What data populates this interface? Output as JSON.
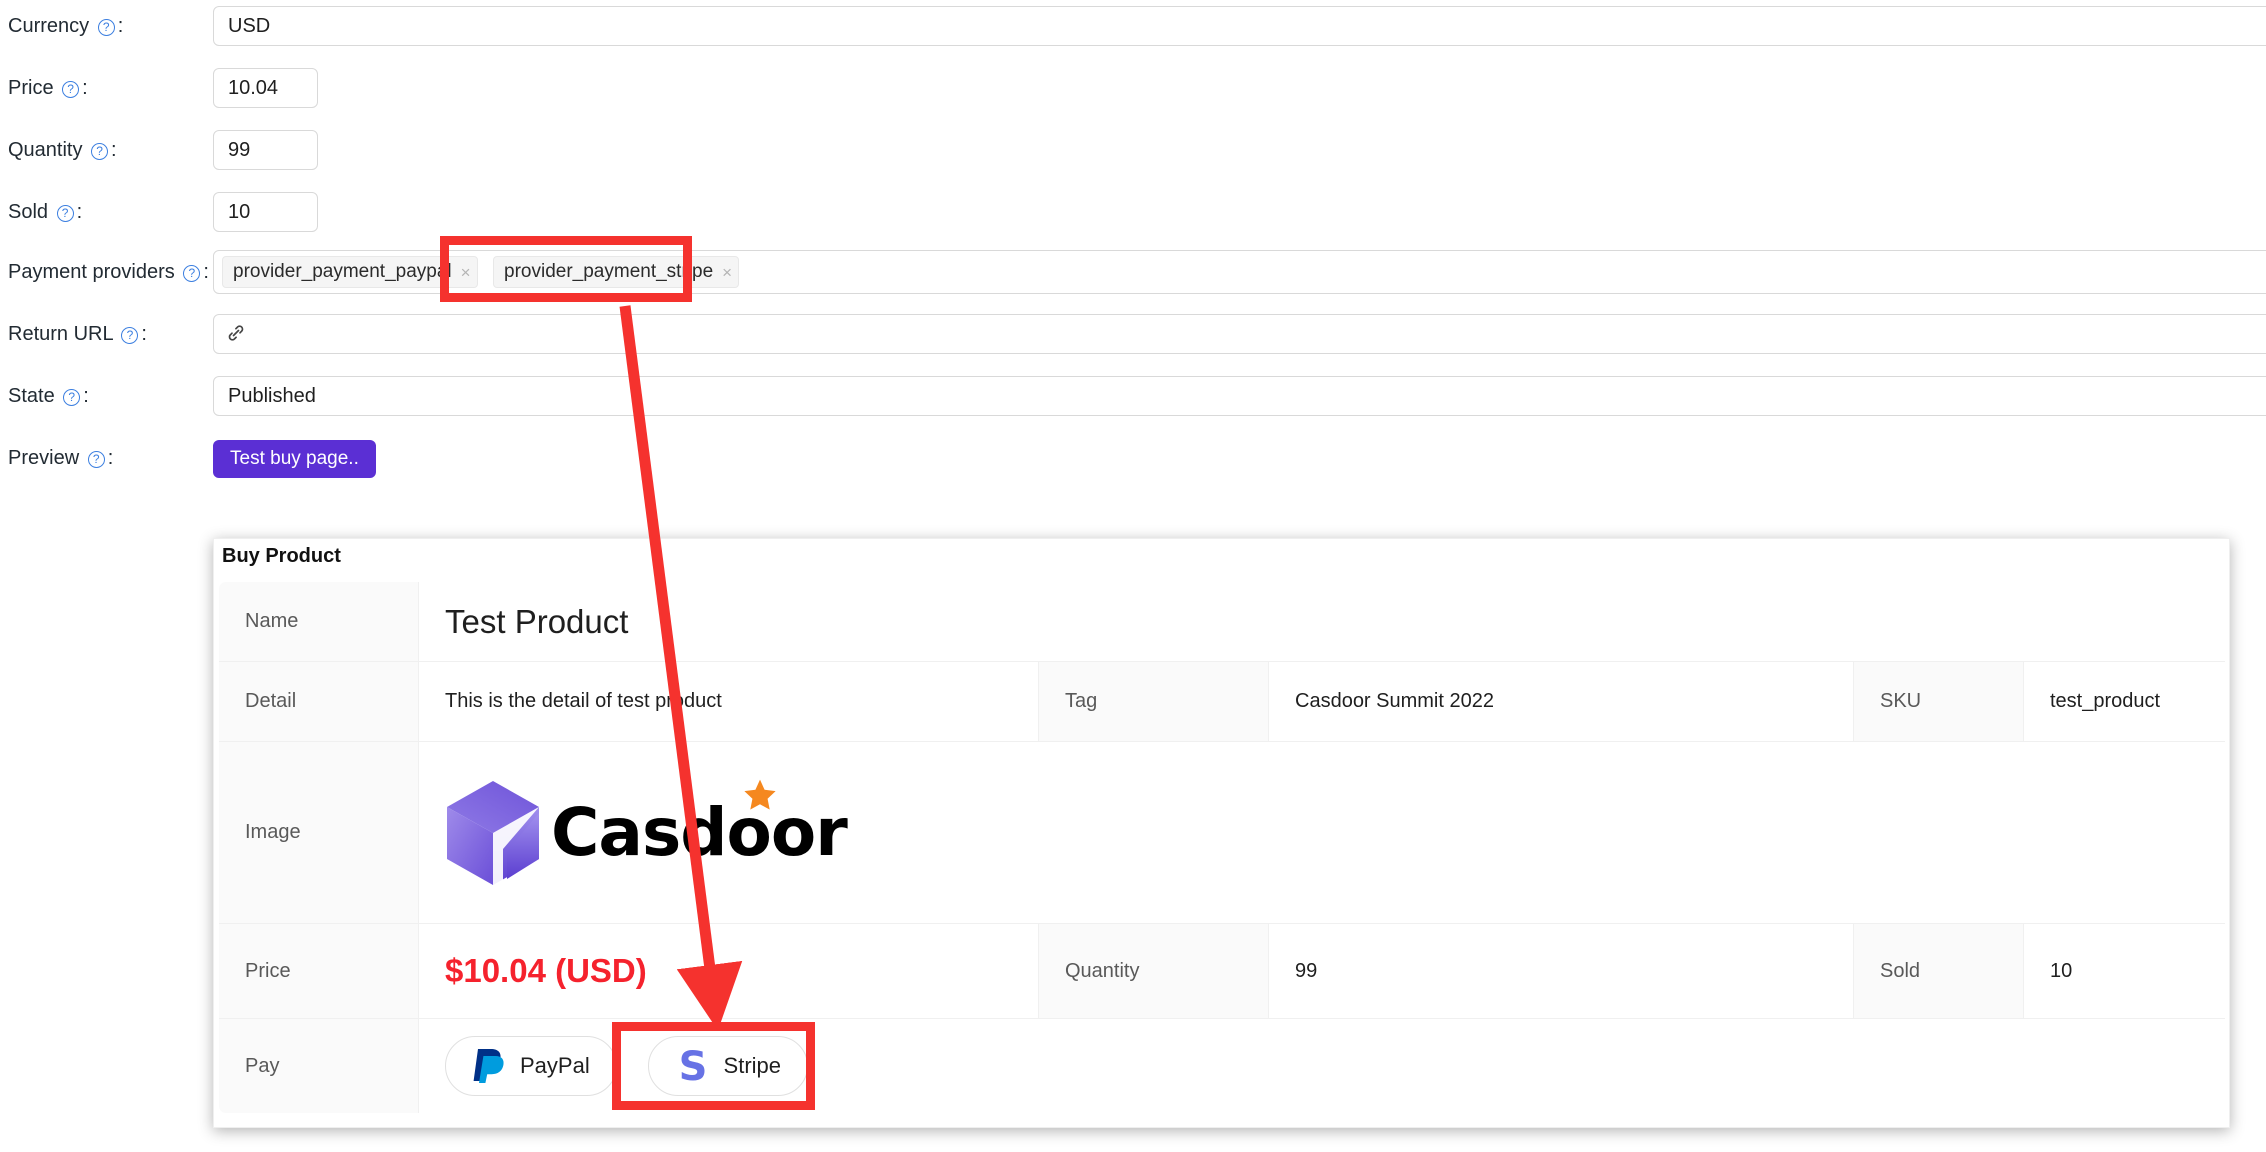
{
  "form": {
    "rows": [
      {
        "label": "Currency",
        "help": "?",
        "value": "USD",
        "type": "text-wide"
      },
      {
        "label": "Price",
        "help": "?",
        "value": "10.04",
        "type": "text-small"
      },
      {
        "label": "Quantity",
        "help": "?",
        "value": "99",
        "type": "text-small"
      },
      {
        "label": "Sold",
        "help": "?",
        "value": "10",
        "type": "text-small"
      },
      {
        "label": "Payment providers",
        "help": "?",
        "value": "",
        "type": "tags"
      },
      {
        "label": "Return URL",
        "help": "?",
        "value": "",
        "type": "url"
      },
      {
        "label": "State",
        "help": "?",
        "value": "Published",
        "type": "text-wide"
      },
      {
        "label": "Preview",
        "help": "?",
        "value": "",
        "type": "button"
      }
    ],
    "colon": ":",
    "payment_providers": [
      {
        "name": "provider_payment_paypal",
        "remove": "×"
      },
      {
        "name": "provider_payment_stripe",
        "remove": "×"
      }
    ],
    "preview_button_label": "Test buy page..",
    "return_url_icon": "link-icon"
  },
  "buy_product": {
    "title": "Buy Product",
    "rows": {
      "name": {
        "label": "Name",
        "value": "Test Product"
      },
      "detail": {
        "label": "Detail",
        "value": "This is the detail of test product",
        "label2": "Tag",
        "value2": "Casdoor Summit 2022",
        "label3": "SKU",
        "value3": "test_product"
      },
      "image": {
        "label": "Image",
        "logo_text": "Casdoor"
      },
      "price": {
        "label": "Price",
        "value": "$10.04 (USD)",
        "label2": "Quantity",
        "value2": "99",
        "label3": "Sold",
        "value3": "10"
      },
      "pay": {
        "label": "Pay",
        "buttons": [
          {
            "label": "PayPal",
            "icon": "paypal-icon"
          },
          {
            "label": "Stripe",
            "icon": "stripe-icon"
          }
        ]
      }
    }
  },
  "annotation": {
    "highlight_color": "#f5322e",
    "arrow_from": "provider_payment_stripe tag",
    "arrow_to": "Stripe pay button"
  },
  "colors": {
    "primary": "#5b2fd4",
    "price_red": "#f5222d",
    "annotation_red": "#f5322e",
    "help_blue": "#3c7fe0",
    "stripe_purple": "#6772e5",
    "paypal_blue": "#003087",
    "paypal_light": "#009cde"
  }
}
